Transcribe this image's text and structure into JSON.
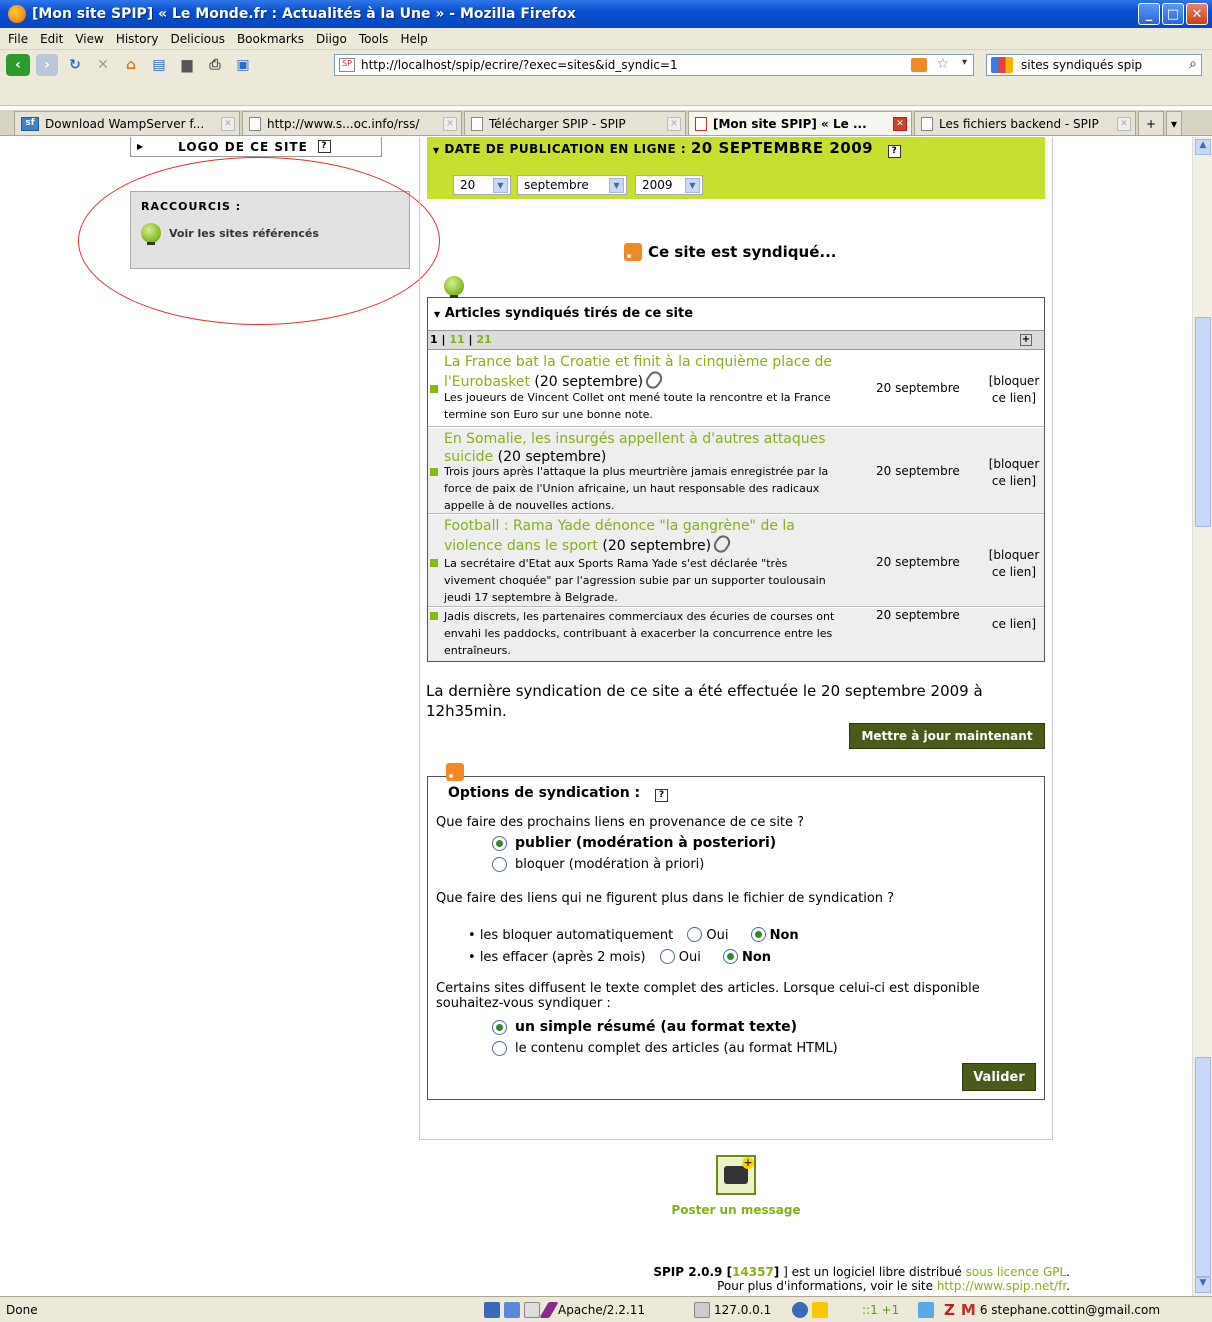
{
  "window": {
    "title": "[Mon site SPIP] « Le Monde.fr : Actualités à la Une » - Mozilla Firefox",
    "min": "_",
    "max": "□",
    "close": "✕"
  },
  "menu": [
    "File",
    "Edit",
    "View",
    "History",
    "Delicious",
    "Bookmarks",
    "Diigo",
    "Tools",
    "Help"
  ],
  "nav": {
    "url": "http://localhost/spip/ecrire/?exec=sites&id_syndic=1",
    "search": "sites syndiqués spip"
  },
  "tabs": [
    {
      "label": "Download WampServer f...",
      "active": false
    },
    {
      "label": "http://www.s...oc.info/rss/",
      "active": false
    },
    {
      "label": "Télécharger SPIP - SPIP",
      "active": false
    },
    {
      "label": "[Mon site SPIP] « Le ...",
      "active": true
    },
    {
      "label": "Les fichiers backend - SPIP",
      "active": false
    }
  ],
  "left": {
    "logo_label": "LOGO DE CE SITE",
    "help": "?",
    "shortcuts_title": "RACCOURCIS :",
    "shortcuts_link": "Voir les sites référencés"
  },
  "date": {
    "label": "DATE DE PUBLICATION EN LIGNE :",
    "value": "20 SEPTEMBRE 2009",
    "day": "20",
    "month": "septembre",
    "year": "2009"
  },
  "syndicated_title": "Ce site est syndiqué...",
  "articles": {
    "title": "Articles syndiqués tirés de ce site",
    "pages": [
      "1",
      "11",
      "21"
    ],
    "rows": [
      {
        "title": "La France bat la Croatie et finit à la cinquième place de l'Eurobasket",
        "date_inline": "(20 septembre)",
        "desc": "Les joueurs de Vincent Collet ont mené toute la rencontre et la France termine son Euro sur une bonne note.",
        "date": "20 septembre",
        "block": "[bloquer ce lien]"
      },
      {
        "title": "En Somalie, les insurgés appellent à d'autres attaques suicide",
        "date_inline": "(20 septembre)",
        "desc": "Trois jours après l'attaque la plus meurtrière jamais enregistrée par la force de paix de l'Union africaine, un haut responsable des radicaux appelle à de nouvelles actions.",
        "date": "20 septembre",
        "block": "[bloquer ce lien]"
      },
      {
        "title": "Football : Rama Yade dénonce \"la gangrène\" de la violence dans le sport",
        "date_inline": "(20 septembre)",
        "desc": "La secrétaire d'Etat aux Sports Rama Yade s'est déclarée \"très vivement choquée\" par l'agression subie par un supporter toulousain jeudi 17 septembre à Belgrade.",
        "date": "20 septembre",
        "block": "[bloquer ce lien]"
      },
      {
        "title": "",
        "date_inline": "",
        "desc": "Jadis discrets, les partenaires commerciaux des écuries de courses ont envahi les paddocks, contribuant à exacerber la concurrence entre les entraîneurs.",
        "date": "20 septembre",
        "block": "ce lien]"
      }
    ]
  },
  "last_sync": "La dernière syndication de ce site a été effectuée le 20 septembre 2009 à 12h35min.",
  "update_button": "Mettre à jour maintenant",
  "options": {
    "title": "Options de syndication :",
    "q1": "Que faire des prochains liens en provenance de ce site ?",
    "q1_a": "publier (modération à posteriori)",
    "q1_b": "bloquer (modération à priori)",
    "q2": "Que faire des liens qui ne figurent plus dans le fichier de syndication ?",
    "q2_a": "les bloquer automatiquement",
    "q2_b": "les effacer (après 2 mois)",
    "oui": "Oui",
    "non": "Non",
    "q3": "Certains sites diffusent le texte complet des articles. Lorsque celui-ci est disponible souhaitez-vous syndiquer :",
    "q3_a": "un simple résumé (au format texte)",
    "q3_b": "le contenu complet des articles (au format HTML)",
    "submit": "Valider"
  },
  "poster": "Poster un message",
  "footer": {
    "line1_a": "SPIP 2.0.9 [",
    "rev": "14357",
    "line1_b": "] est un logiciel libre distribué ",
    "licence": "sous licence GPL",
    "line2": "Pour plus d'informations, voir le site ",
    "site": "http://www.spip.net/fr"
  },
  "status": {
    "done": "Done",
    "apache": "Apache/2.2.11",
    "ip": "127.0.0.1",
    "counter": "::1 +1",
    "mail": "6 stephane.cottin@gmail.com"
  }
}
